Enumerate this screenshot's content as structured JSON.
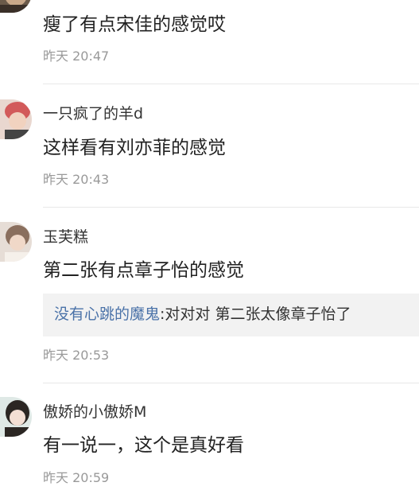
{
  "comments": [
    {
      "username": "",
      "content": "瘦了有点宋佳的感觉哎",
      "time": "昨天 20:47"
    },
    {
      "username": "一只疯了的羊d",
      "content": "这样看有刘亦菲的感觉",
      "time": "昨天 20:43"
    },
    {
      "username": "玉芙糕",
      "content": "第二张有点章子怡的感觉",
      "reply": {
        "name": "没有心跳的魔鬼",
        "text": ":对对对 第二张太像章子怡了"
      },
      "time": "昨天 20:53"
    },
    {
      "username": "傲娇的小傲娇M",
      "content": "有一说一，这个是真好看",
      "time": "昨天 20:59"
    }
  ]
}
